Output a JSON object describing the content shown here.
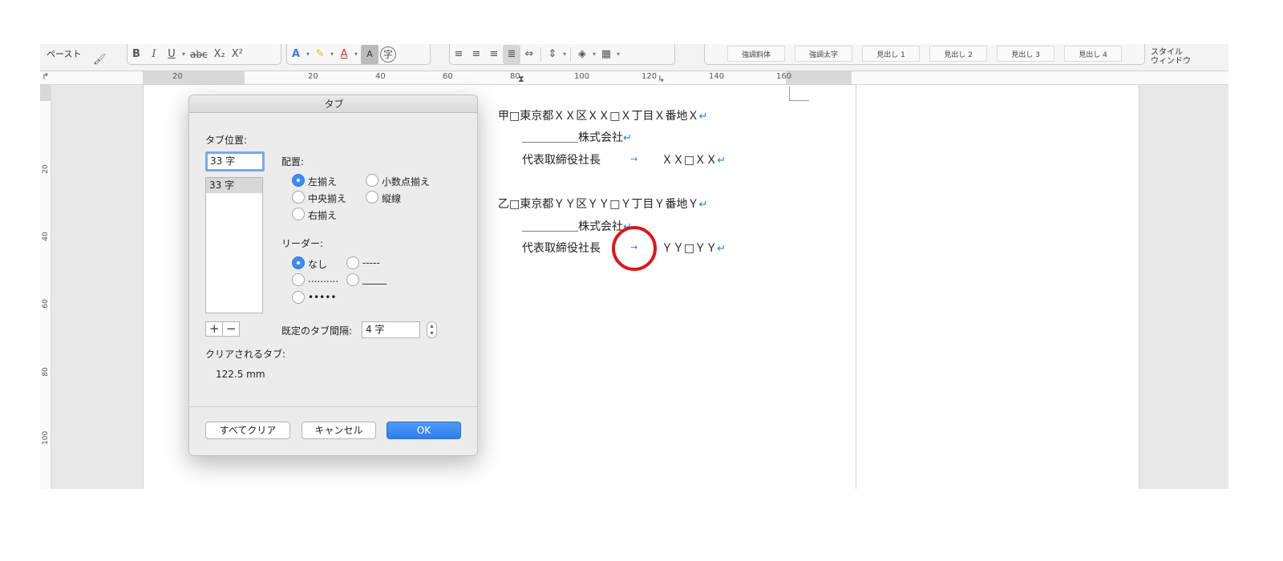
{
  "ribbon": {
    "paste_label": "ペースト",
    "format_buttons": [
      "B",
      "I",
      "U",
      "abc",
      "X₂",
      "X²"
    ],
    "styles": [
      "強調斜体",
      "強調太字",
      "見出し 1",
      "見出し 2",
      "見出し 3",
      "見出し 4"
    ],
    "style_window_line1": "スタイル",
    "style_window_line2": "ウィンドウ"
  },
  "ruler": {
    "numbers": [
      "20",
      "20",
      "40",
      "60",
      "80",
      "100",
      "120",
      "140",
      "160"
    ]
  },
  "vruler": {
    "numbers": [
      "20",
      "40",
      "60",
      "80",
      "100"
    ]
  },
  "document": {
    "line1": "甲□東京都ＸＸ区ＸＸ□Ｘ丁目Ｘ番地Ｘ",
    "line2": "＿＿＿＿＿株式会社",
    "line3_left": "代表取締役社長",
    "line3_right": "ＸＸ□ＸＸ",
    "line4": "乙□東京都ＹＹ区ＹＹ□Ｙ丁目Ｙ番地Ｙ",
    "line5": "＿＿＿＿＿株式会社",
    "line6_left": "代表取締役社長",
    "line6_right": "ＹＹ□ＹＹ",
    "return_mark": "↵",
    "tab_mark": "→"
  },
  "dialog": {
    "title": "タブ",
    "tab_position_label": "タブ位置:",
    "tab_position_value": "33 字",
    "tab_list": [
      "33 字"
    ],
    "alignment_label": "配置:",
    "align_left": "左揃え",
    "align_center": "中央揃え",
    "align_right": "右揃え",
    "align_decimal": "小数点揃え",
    "align_bar": "縦線",
    "leader_label": "リーダー:",
    "leader_none": "なし",
    "leader_dashes": "-----",
    "leader_dots": "..........",
    "leader_underline": "_____",
    "leader_bullets": "•••••",
    "plus": "+",
    "minus": "−",
    "default_tab_label": "既定のタブ間隔:",
    "default_tab_value": "4 字",
    "cleared_label": "クリアされるタブ:",
    "cleared_value": "122.5 mm",
    "clear_all": "すべてクリア",
    "cancel": "キャンセル",
    "ok": "OK"
  },
  "colors": {
    "accent": "#2d7ef0",
    "mark_blue": "#2a7de1",
    "highlight_red": "#e0141b"
  }
}
